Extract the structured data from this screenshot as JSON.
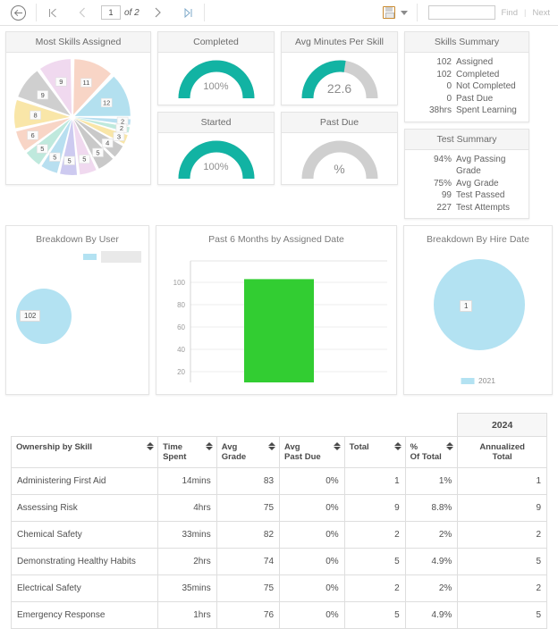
{
  "toolbar": {
    "back_icon": "circle-back-arrow-icon",
    "first_page_icon": "first-page-icon",
    "prev_page_icon": "prev-page-icon",
    "next_page_icon": "next-page-icon",
    "last_page_icon": "last-page-icon",
    "page_value": "1",
    "page_of": "of 2",
    "export_icon": "save-export-icon",
    "export_chevron_icon": "chevron-down-icon",
    "find_value": "",
    "find_placeholder": "",
    "find_label": "Find",
    "find_separator": "|",
    "next_label": "Next"
  },
  "pie": {
    "title": "Most Skills Assigned",
    "chart": {
      "type": "pie",
      "title": "Most Skills Assigned",
      "labels": [
        "12",
        "2",
        "2",
        "3",
        "4",
        "5",
        "5",
        "5",
        "5",
        "5",
        "6",
        "8",
        "9",
        "9",
        "11"
      ],
      "values": [
        12,
        2,
        2,
        3,
        4,
        5,
        5,
        5,
        5,
        5,
        6,
        8,
        9,
        9,
        11
      ],
      "colors": [
        "#b3e0ef",
        "#b3d9ee",
        "#bfe9dd",
        "#f9e6a8",
        "#c9c9c9",
        "#c9c9c9",
        "#f0d9ef",
        "#cdcaf0",
        "#f8d5c6",
        "#b8dff0",
        "#bfe9dd",
        "#f9e6a8",
        "#cfcfcf",
        "#f0d9ef",
        "#cdcaf0",
        "#f8d5c6"
      ],
      "exploded": true,
      "legend": false
    }
  },
  "gauges": [
    {
      "title": "Completed",
      "value": "100%",
      "fill_pct": 100,
      "big": false
    },
    {
      "title": "Avg Minutes Per Skill",
      "value": "22.6",
      "fill_pct": 55,
      "big": true
    },
    {
      "title": "Started",
      "value": "100%",
      "fill_pct": 100,
      "big": false
    },
    {
      "title": "Past Due",
      "value": "%",
      "fill_pct": 0,
      "big": true
    }
  ],
  "skills_summary": {
    "title": "Skills Summary",
    "rows": [
      {
        "num": "102",
        "label": "Assigned"
      },
      {
        "num": "102",
        "label": "Completed"
      },
      {
        "num": "0",
        "label": "Not Completed"
      },
      {
        "num": "0",
        "label": "Past Due"
      },
      {
        "num": "38hrs",
        "label": "Spent Learning"
      }
    ]
  },
  "test_summary": {
    "title": "Test Summary",
    "rows": [
      {
        "num": "94%",
        "label": "Avg Passing Grade"
      },
      {
        "num": "75%",
        "label": "Avg Grade"
      },
      {
        "num": "99",
        "label": "Test Passed"
      },
      {
        "num": "227",
        "label": "Test Attempts"
      }
    ]
  },
  "breakdown_user": {
    "title": "Breakdown By User",
    "bubble_label": "102",
    "legend_label": "",
    "chart": {
      "type": "scatter",
      "title": "Breakdown By User",
      "points": [
        {
          "label": "102",
          "value": 102
        }
      ],
      "color": "#b3e2f2",
      "legend": "top-right",
      "legend_entries": [
        ""
      ]
    }
  },
  "bar_chart": {
    "title": "Past 6 Months by Assigned Date",
    "chart": {
      "type": "bar",
      "title": "Past 6 Months by Assigned Date",
      "categories": [
        ""
      ],
      "values": [
        102
      ],
      "ticks": [
        "100",
        "80",
        "60",
        "40",
        "20"
      ],
      "ylim": [
        0,
        120
      ],
      "xlabel": "",
      "ylabel": "",
      "grid": true,
      "color": "#32cd32"
    }
  },
  "breakdown_hire": {
    "title": "Breakdown By Hire Date",
    "bubble_label": "1",
    "legend_label": "2021",
    "chart": {
      "type": "scatter",
      "title": "Breakdown By Hire Date",
      "points": [
        {
          "label": "1",
          "value": 1
        }
      ],
      "color": "#b3e2f2",
      "legend": "bottom",
      "legend_entries": [
        "2021"
      ]
    }
  },
  "table": {
    "group_header": "2024",
    "columns": [
      {
        "label": "Ownership by Skill",
        "sortable": true,
        "align": "left"
      },
      {
        "label": "Time\nSpent",
        "sortable": true,
        "align": "left"
      },
      {
        "label": "Avg\nGrade",
        "sortable": true,
        "align": "left"
      },
      {
        "label": "Avg\nPast Due",
        "sortable": true,
        "align": "left"
      },
      {
        "label": "Total",
        "sortable": true,
        "align": "left"
      },
      {
        "label": "%\nOf Total",
        "sortable": true,
        "align": "left"
      },
      {
        "label": "Annualized\nTotal",
        "sortable": false,
        "align": "center"
      }
    ],
    "col_labels": {
      "c0": "Ownership by Skill",
      "c1a": "Time",
      "c1b": "Spent",
      "c2a": "Avg",
      "c2b": "Grade",
      "c3a": "Avg",
      "c3b": "Past Due",
      "c4": "Total",
      "c5a": "%",
      "c5b": "Of Total",
      "c6a": "Annualized",
      "c6b": "Total"
    },
    "rows": [
      {
        "skill": "Administering First Aid",
        "time": "14mins",
        "grade": "83",
        "past_due": "0%",
        "total": "1",
        "pct": "1%",
        "annualized": "1"
      },
      {
        "skill": "Assessing Risk",
        "time": "4hrs",
        "grade": "75",
        "past_due": "0%",
        "total": "9",
        "pct": "8.8%",
        "annualized": "9"
      },
      {
        "skill": "Chemical Safety",
        "time": "33mins",
        "grade": "82",
        "past_due": "0%",
        "total": "2",
        "pct": "2%",
        "annualized": "2"
      },
      {
        "skill": "Demonstrating Healthy Habits",
        "time": "2hrs",
        "grade": "74",
        "past_due": "0%",
        "total": "5",
        "pct": "4.9%",
        "annualized": "5"
      },
      {
        "skill": "Electrical Safety",
        "time": "35mins",
        "grade": "75",
        "past_due": "0%",
        "total": "2",
        "pct": "2%",
        "annualized": "2"
      },
      {
        "skill": "Emergency Response",
        "time": "1hrs",
        "grade": "76",
        "past_due": "0%",
        "total": "5",
        "pct": "4.9%",
        "annualized": "5"
      }
    ]
  },
  "colors": {
    "gauge_teal": "#12b3a3",
    "gauge_track": "#cfcfcf",
    "bar_green": "#32cd32",
    "bubble_blue": "#b3e2f2"
  }
}
